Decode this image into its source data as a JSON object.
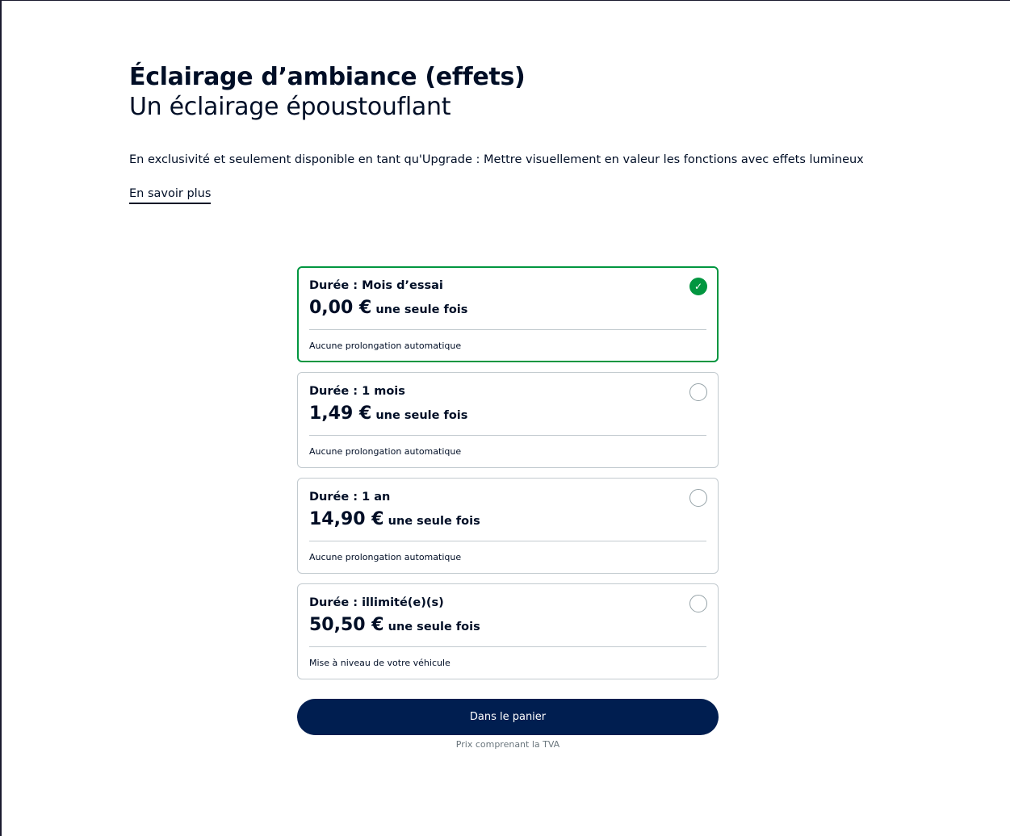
{
  "header": {
    "title": "Éclairage d’ambiance (effets)",
    "subtitle": "Un éclairage époustouflant"
  },
  "description": "En exclusivité et seulement disponible en tant qu'Upgrade : Mettre visuellement en valeur les fonctions avec effets lumineux",
  "learn_more_label": "En savoir plus",
  "options": [
    {
      "duration": "Durée : Mois d’essai",
      "price": "0,00 €",
      "price_suffix": "une seule fois",
      "note": "Aucune prolongation automatique",
      "selected": true,
      "check_glyph": "✓"
    },
    {
      "duration": "Durée : 1 mois",
      "price": "1,49 €",
      "price_suffix": "une seule fois",
      "note": "Aucune prolongation automatique",
      "selected": false
    },
    {
      "duration": "Durée : 1 an",
      "price": "14,90 €",
      "price_suffix": "une seule fois",
      "note": "Aucune prolongation automatique",
      "selected": false
    },
    {
      "duration": "Durée : illimité(e)(s)",
      "price": "50,50 €",
      "price_suffix": "une seule fois",
      "note": "Mise à niveau de votre véhicule",
      "selected": false
    }
  ],
  "cart_button_label": "Dans le panier",
  "vat_note": "Prix comprenant la TVA",
  "colors": {
    "brand_dark": "#001e50",
    "selected_green": "#029640",
    "border_grey": "#c2cacf"
  },
  "icons": {
    "selected": "check-circle-icon",
    "unselected": "radio-empty-icon"
  }
}
